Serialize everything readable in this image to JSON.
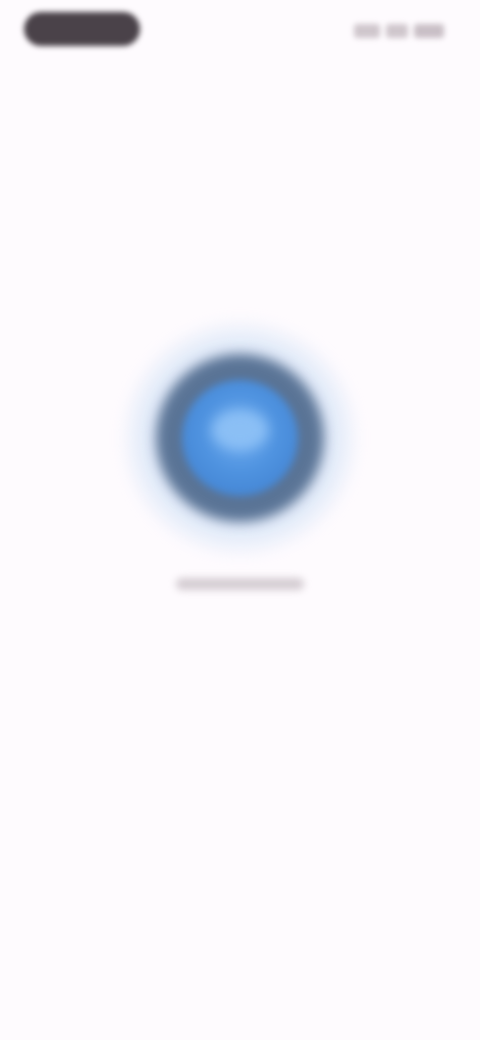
{
  "status_bar": {
    "time": "",
    "icons": [
      "signal-icon",
      "wifi-icon",
      "battery-icon"
    ]
  },
  "loader": {
    "icon": "loading-spinner-icon",
    "accent_color": "#4f93e0",
    "ring_color": "#5a7496"
  },
  "loading_text": "",
  "background_color": "#fefbfe"
}
